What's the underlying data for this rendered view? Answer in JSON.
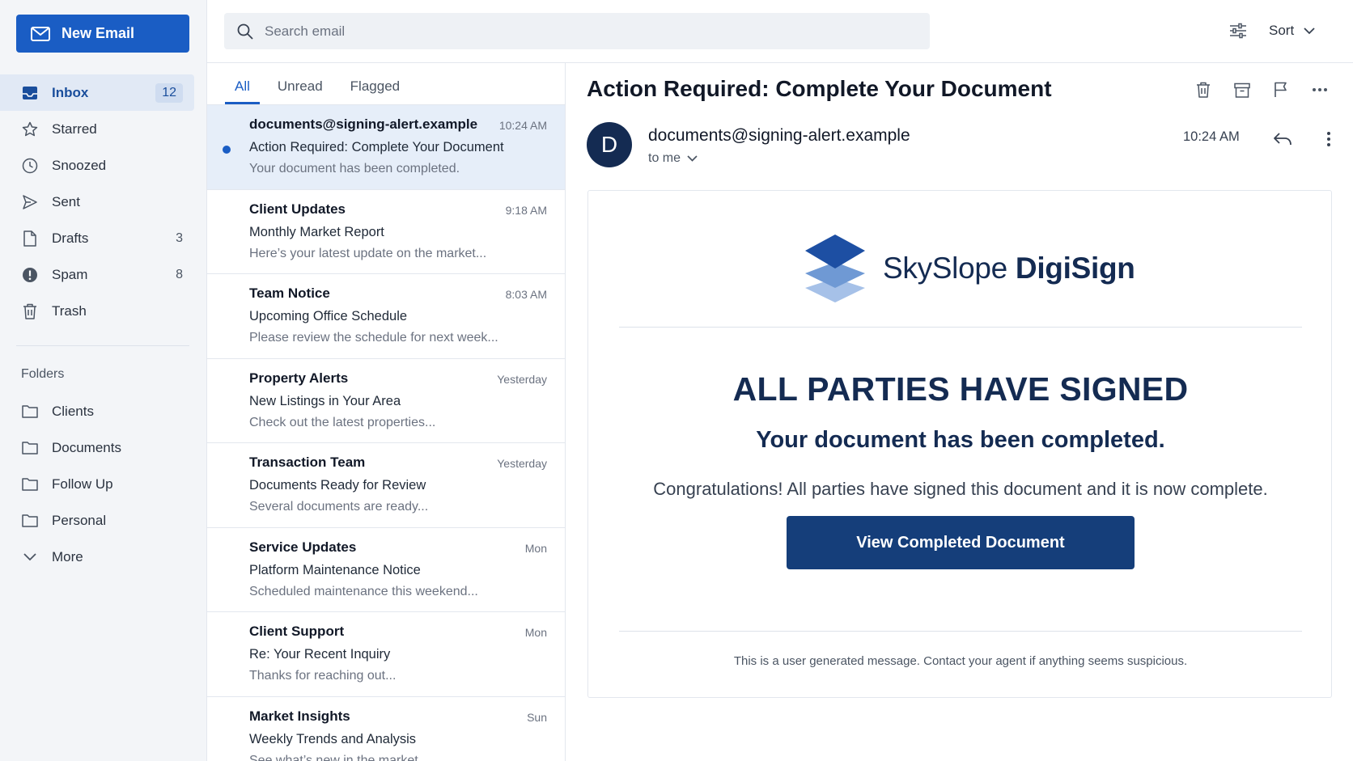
{
  "compose": {
    "label": "New Email"
  },
  "sidebar": {
    "items": [
      {
        "label": "Inbox",
        "count": "12",
        "icon": "inbox-icon",
        "active": true
      },
      {
        "label": "Starred",
        "count": "",
        "icon": "star-icon"
      },
      {
        "label": "Snoozed",
        "count": "",
        "icon": "clock-icon"
      },
      {
        "label": "Sent",
        "count": "",
        "icon": "send-icon"
      },
      {
        "label": "Drafts",
        "count": "3",
        "icon": "draft-icon"
      },
      {
        "label": "Spam",
        "count": "8",
        "icon": "spam-icon"
      },
      {
        "label": "Trash",
        "count": "",
        "icon": "trash-icon"
      }
    ],
    "folders_title": "Folders",
    "folders": [
      {
        "label": "Clients"
      },
      {
        "label": "Documents"
      },
      {
        "label": "Follow Up"
      },
      {
        "label": "Personal"
      },
      {
        "label": "More"
      }
    ]
  },
  "search": {
    "placeholder": "Search email"
  },
  "toolbar": {
    "sort_label": "Sort"
  },
  "tabs": [
    {
      "label": "All"
    },
    {
      "label": "Unread"
    },
    {
      "label": "Flagged"
    }
  ],
  "messages": [
    {
      "sender": "documents@signing-alert.example",
      "time": "10:24 AM",
      "subject": "Action Required: Complete Your Document",
      "preview": "Your document has been completed.",
      "unread": true,
      "selected": true
    },
    {
      "sender": "Client Updates",
      "time": "9:18 AM",
      "subject": "Monthly Market Report",
      "preview": "Here’s your latest update on the market..."
    },
    {
      "sender": "Team Notice",
      "time": "8:03 AM",
      "subject": "Upcoming Office Schedule",
      "preview": "Please review the schedule for next week..."
    },
    {
      "sender": "Property Alerts",
      "time": "Yesterday",
      "subject": "New Listings in Your Area",
      "preview": "Check out the latest properties..."
    },
    {
      "sender": "Transaction Team",
      "time": "Yesterday",
      "subject": "Documents Ready for Review",
      "preview": "Several documents are ready..."
    },
    {
      "sender": "Service Updates",
      "time": "Mon",
      "subject": "Platform Maintenance Notice",
      "preview": "Scheduled maintenance this weekend..."
    },
    {
      "sender": "Client Support",
      "time": "Mon",
      "subject": "Re: Your Recent Inquiry",
      "preview": "Thanks for reaching out..."
    },
    {
      "sender": "Market Insights",
      "time": "Sun",
      "subject": "Weekly Trends and Analysis",
      "preview": "See what’s new in the market..."
    }
  ],
  "reader": {
    "subject": "Action Required: Complete Your Document",
    "avatar_letter": "D",
    "from": "documents@signing-alert.example",
    "to": "to me",
    "time": "10:24 AM",
    "email": {
      "brand_light": "SkySlope",
      "brand_bold": "DigiSign",
      "headline": "ALL PARTIES HAVE SIGNED",
      "subheadline": "Your document has been completed.",
      "body": "Congratulations! All parties have signed this document and it is now complete.",
      "cta": "View Completed Document",
      "disclaimer": "This is a user generated message. Contact your agent if anything seems suspicious."
    }
  },
  "colors": {
    "accent": "#1a5dc4",
    "brand_navy": "#142b52",
    "cta": "#153e7a",
    "selected_row": "#e6eef9"
  }
}
